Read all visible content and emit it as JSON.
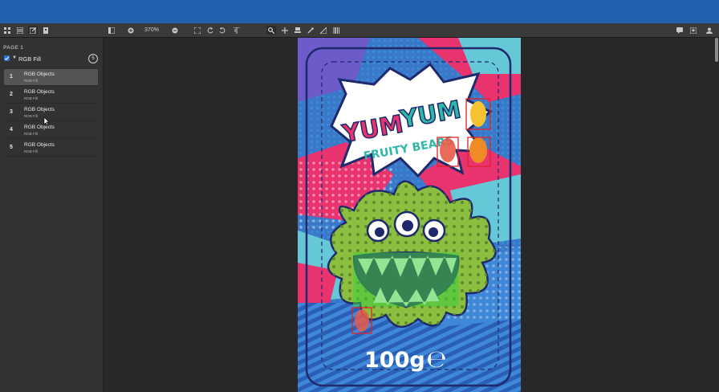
{
  "toolbar": {
    "zoom_label": "370%"
  },
  "sidebar": {
    "page_label": "PAGE 1",
    "layer": {
      "title": "RGB Fill",
      "count": "5"
    },
    "objects": [
      {
        "num": "1",
        "name": "RGB Objects",
        "sub": "RGB Fill"
      },
      {
        "num": "2",
        "name": "RGB Objects",
        "sub": "RGB Fill"
      },
      {
        "num": "3",
        "name": "RGB Objects",
        "sub": "RGB Fill"
      },
      {
        "num": "4",
        "name": "RGB Objects",
        "sub": "RGB Fill"
      },
      {
        "num": "5",
        "name": "RGB Objects",
        "sub": "RGB Fill"
      }
    ]
  },
  "artwork": {
    "brand_left": "YUM",
    "brand_right": "YUM",
    "tagline": "FRUITY BEARS",
    "weight": "100g",
    "estimated_mark": "℮"
  },
  "colors": {
    "topbar": "#2262ad",
    "highlight_green": "#3ecf3e",
    "highlight_red": "#e0242b"
  }
}
